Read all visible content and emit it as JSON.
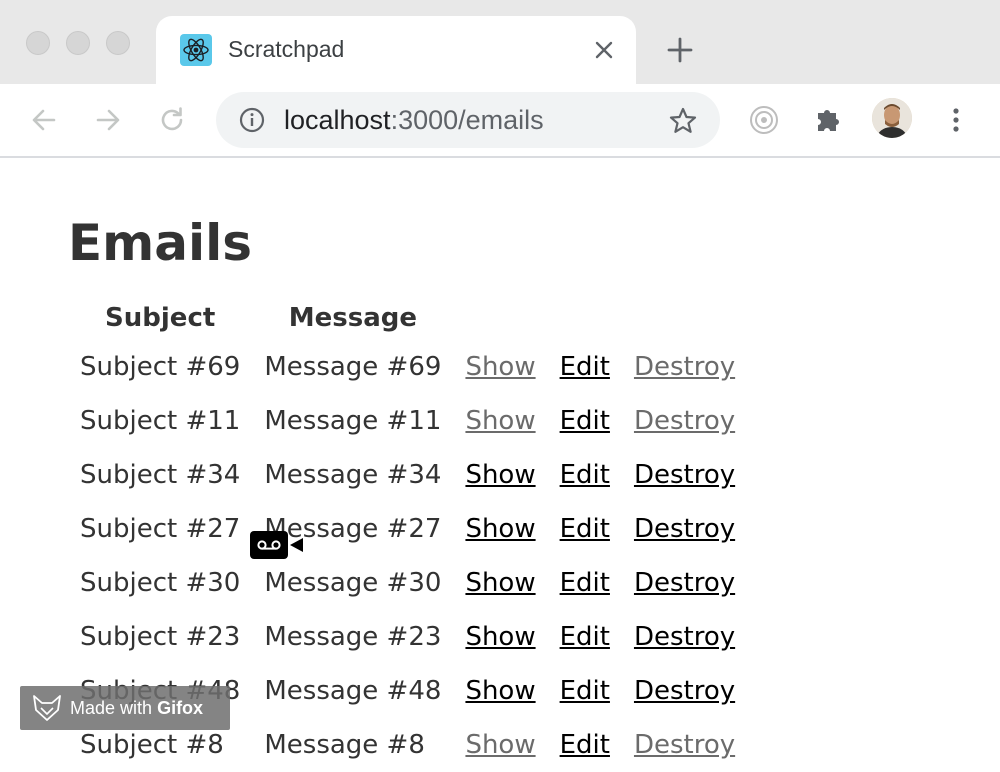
{
  "browser": {
    "tab": {
      "title": "Scratchpad",
      "favicon": "react-logo-icon"
    },
    "address": {
      "host": "localhost",
      "rest": ":3000/emails"
    }
  },
  "page": {
    "title": "Emails",
    "columns": [
      "Subject",
      "Message"
    ],
    "rows": [
      {
        "subject": "Subject #69",
        "message": "Message #69",
        "show": "Show",
        "edit": "Edit",
        "destroy": "Destroy",
        "show_visited": true,
        "destroy_visited": true
      },
      {
        "subject": "Subject #11",
        "message": "Message #11",
        "show": "Show",
        "edit": "Edit",
        "destroy": "Destroy",
        "show_visited": true,
        "destroy_visited": true
      },
      {
        "subject": "Subject #34",
        "message": "Message #34",
        "show": "Show",
        "edit": "Edit",
        "destroy": "Destroy",
        "show_visited": false,
        "destroy_visited": false
      },
      {
        "subject": "Subject #27",
        "message": "Message #27",
        "show": "Show",
        "edit": "Edit",
        "destroy": "Destroy",
        "show_visited": false,
        "destroy_visited": false
      },
      {
        "subject": "Subject #30",
        "message": "Message #30",
        "show": "Show",
        "edit": "Edit",
        "destroy": "Destroy",
        "show_visited": false,
        "destroy_visited": false
      },
      {
        "subject": "Subject #23",
        "message": "Message #23",
        "show": "Show",
        "edit": "Edit",
        "destroy": "Destroy",
        "show_visited": false,
        "destroy_visited": false
      },
      {
        "subject": "Subject #48",
        "message": "Message #48",
        "show": "Show",
        "edit": "Edit",
        "destroy": "Destroy",
        "show_visited": false,
        "destroy_visited": false
      },
      {
        "subject": "Subject #8",
        "message": "Message #8",
        "show": "Show",
        "edit": "Edit",
        "destroy": "Destroy",
        "show_visited": true,
        "destroy_visited": true
      }
    ]
  },
  "overlay": {
    "watermark": {
      "prefix": "Made with",
      "brand": "Gifox"
    }
  },
  "colors": {
    "link": "#000000",
    "link_visited": "#6b6b6b",
    "text": "#333333",
    "tabstrip": "#e8e8e8",
    "omnibox": "#f1f3f4"
  }
}
